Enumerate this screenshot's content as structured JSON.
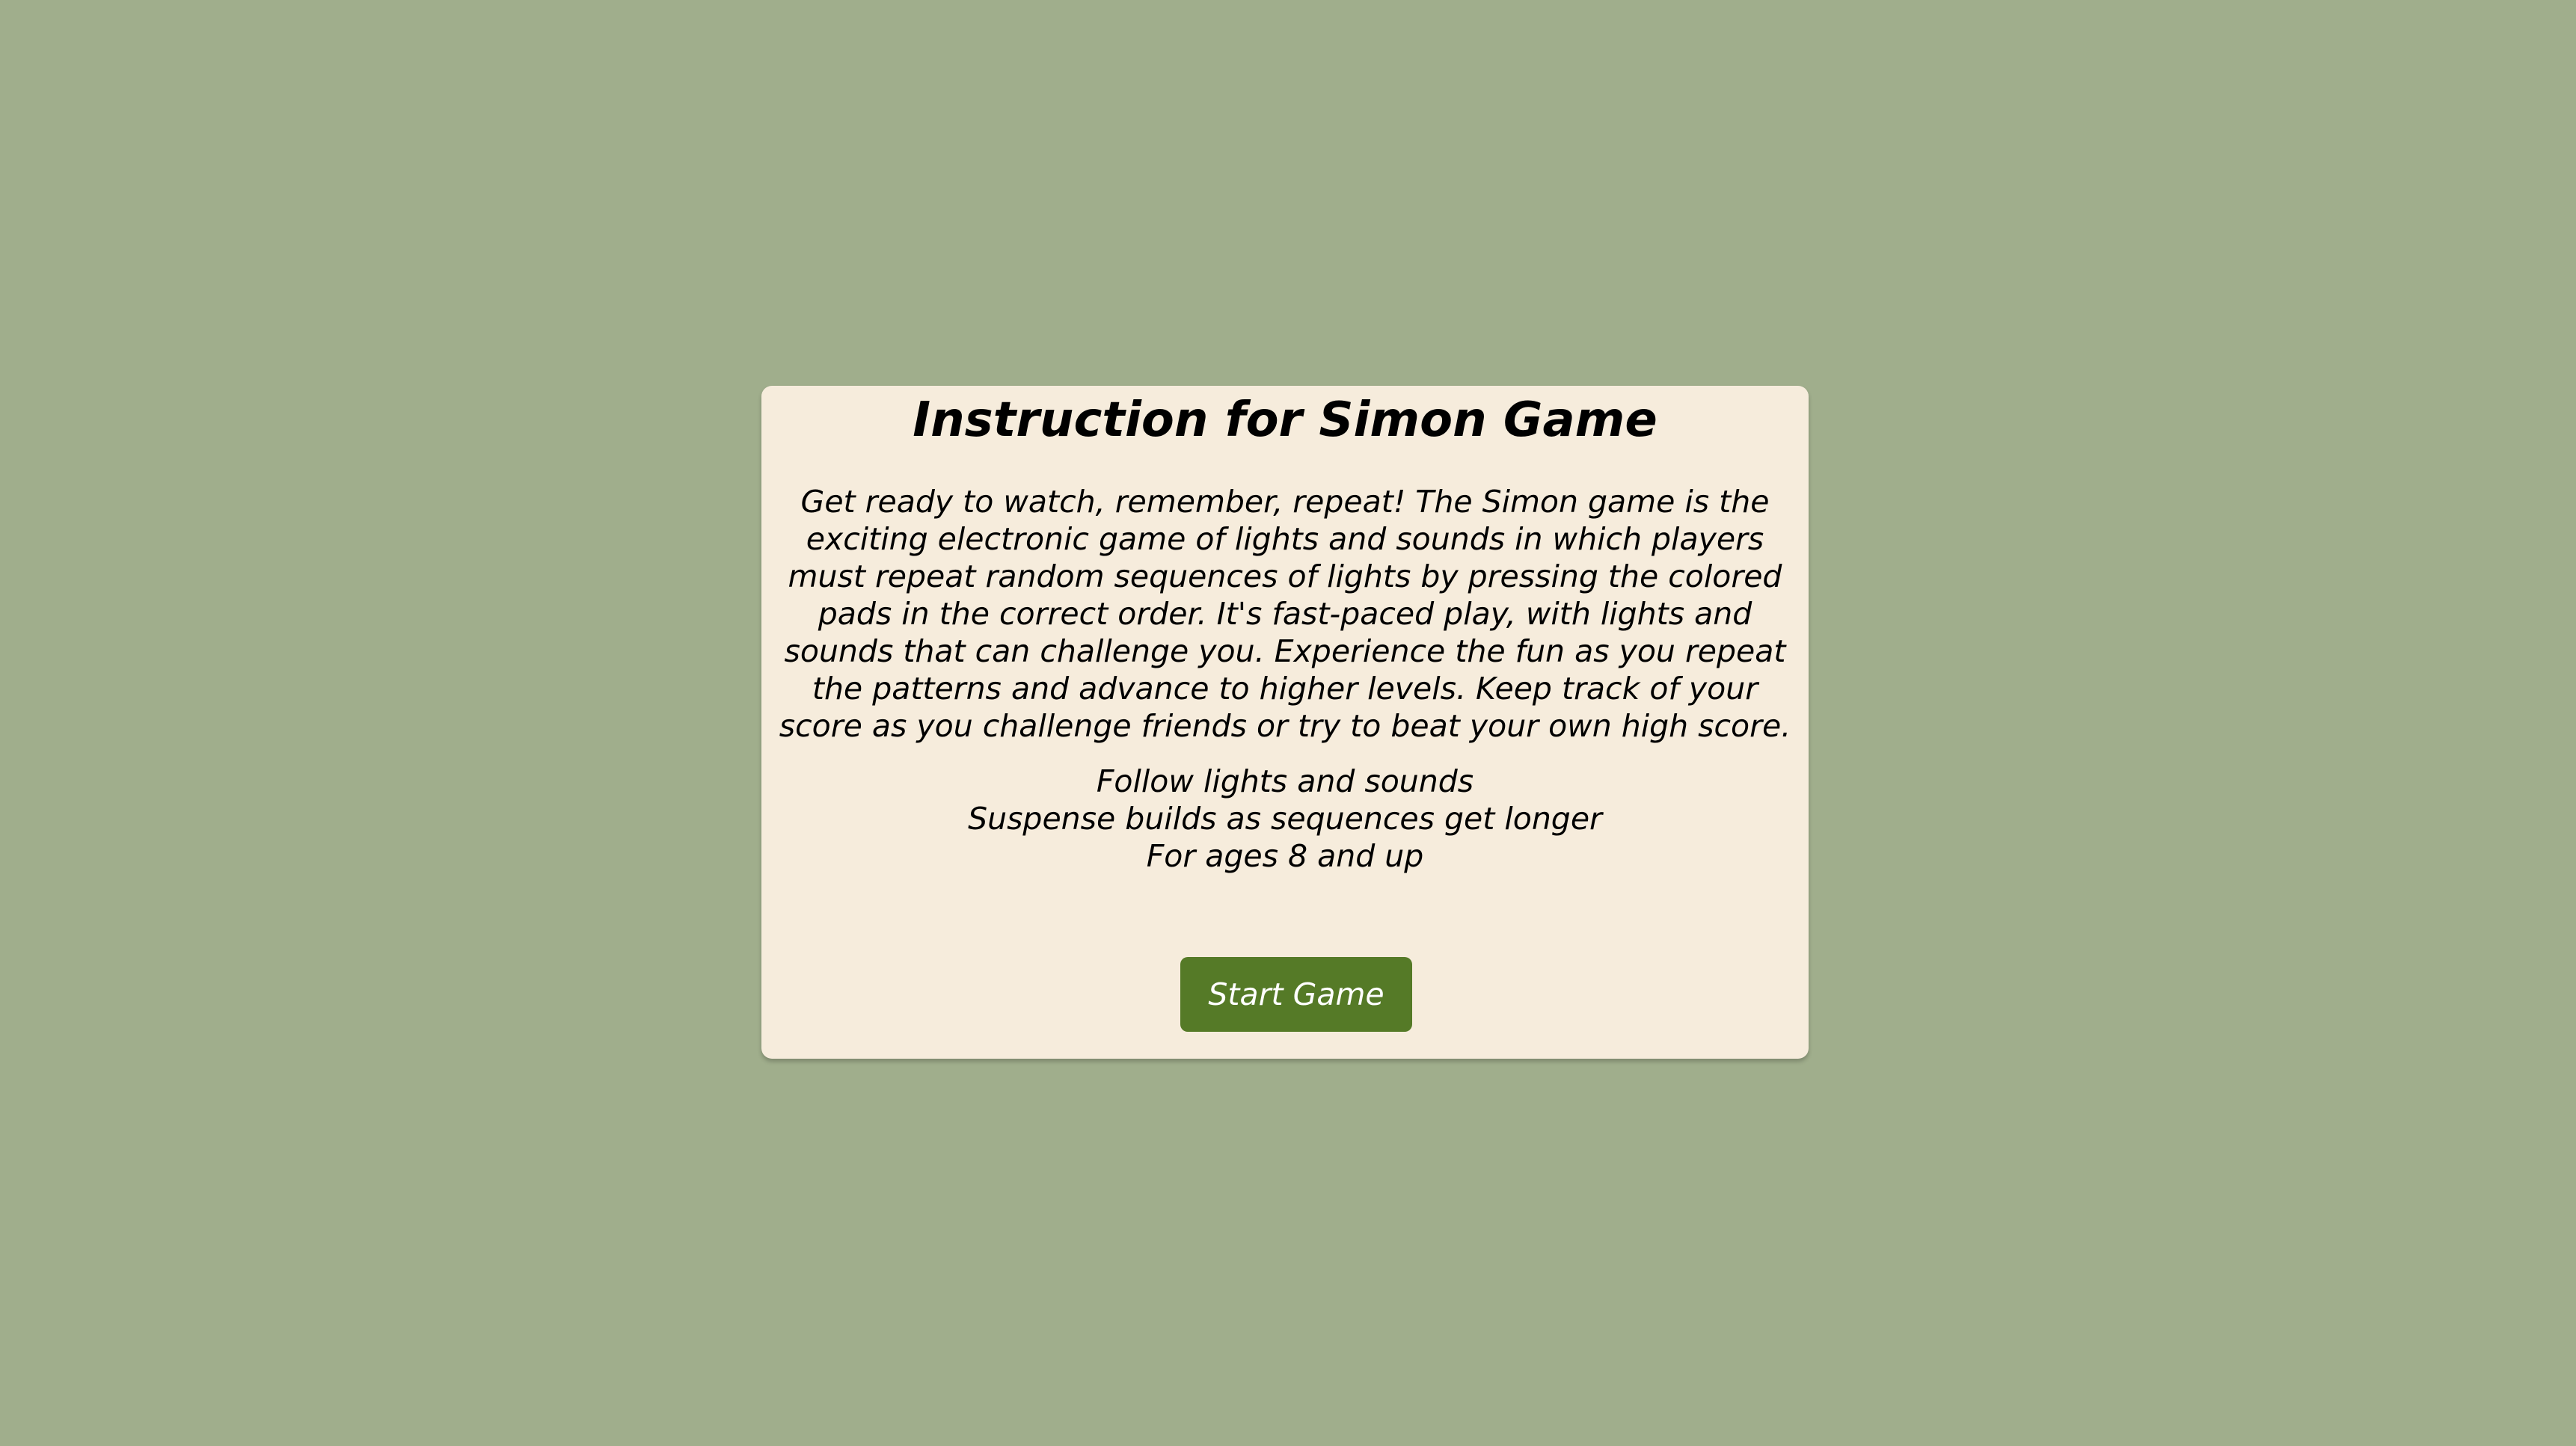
{
  "colors": {
    "background": "#a0ae8c",
    "card": "#f6ecdc",
    "button": "#557a27",
    "button_text": "#ffffff"
  },
  "instructions": {
    "title": "Instruction for Simon Game",
    "description": "Get ready to watch, remember, repeat! The Simon game is the exciting electronic game of lights and sounds in which players must repeat random sequences of lights by pressing the colored pads in the correct order. It's fast-paced play, with lights and sounds that can challenge you. Experience the fun as you repeat the patterns and advance to higher levels. Keep track of your score as you challenge friends or try to beat your own high score.",
    "features": [
      "Follow lights and sounds",
      "Suspense builds as sequences get longer",
      "For ages 8 and up"
    ],
    "start_button_label": "Start Game"
  }
}
